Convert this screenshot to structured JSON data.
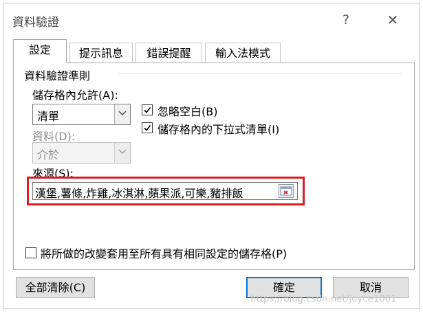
{
  "dialog": {
    "title": "資料驗證",
    "help_glyph": "?",
    "close_glyph": "✕"
  },
  "tabs": [
    {
      "label": "設定",
      "active": true
    },
    {
      "label": "提示訊息",
      "active": false
    },
    {
      "label": "錯誤提醒",
      "active": false
    },
    {
      "label": "輸入法模式",
      "active": false
    }
  ],
  "criteria": {
    "group_label": "資料驗證準則",
    "allow_label": "儲存格內允許",
    "allow_hotkey": "(A):",
    "allow_value": "清單",
    "ignore_blank_label": "忽略空白",
    "ignore_blank_hotkey": "(B)",
    "ignore_blank_checked": true,
    "in_cell_dropdown_label": "儲存格內的下拉式清單",
    "in_cell_dropdown_hotkey": "(I)",
    "in_cell_dropdown_checked": true,
    "data_label": "資料",
    "data_hotkey": "(D):",
    "data_value": "介於",
    "source_label": "來源",
    "source_hotkey": "(S):",
    "source_value": "漢堡,薯條,炸雞,冰淇淋,蘋果派,可樂,豬排飯"
  },
  "apply_all": {
    "label": "將所做的改變套用至所有具有相同設定的儲存格",
    "hotkey": "(P)",
    "checked": false
  },
  "buttons": {
    "clear_all": "全部清除",
    "clear_all_hotkey": "(C)",
    "ok": "確定",
    "cancel": "取消"
  },
  "watermark": "https://blog.csdn.net/joyce1001",
  "colors": {
    "highlight": "#e0191f",
    "default_button_border": "#0078d7"
  }
}
